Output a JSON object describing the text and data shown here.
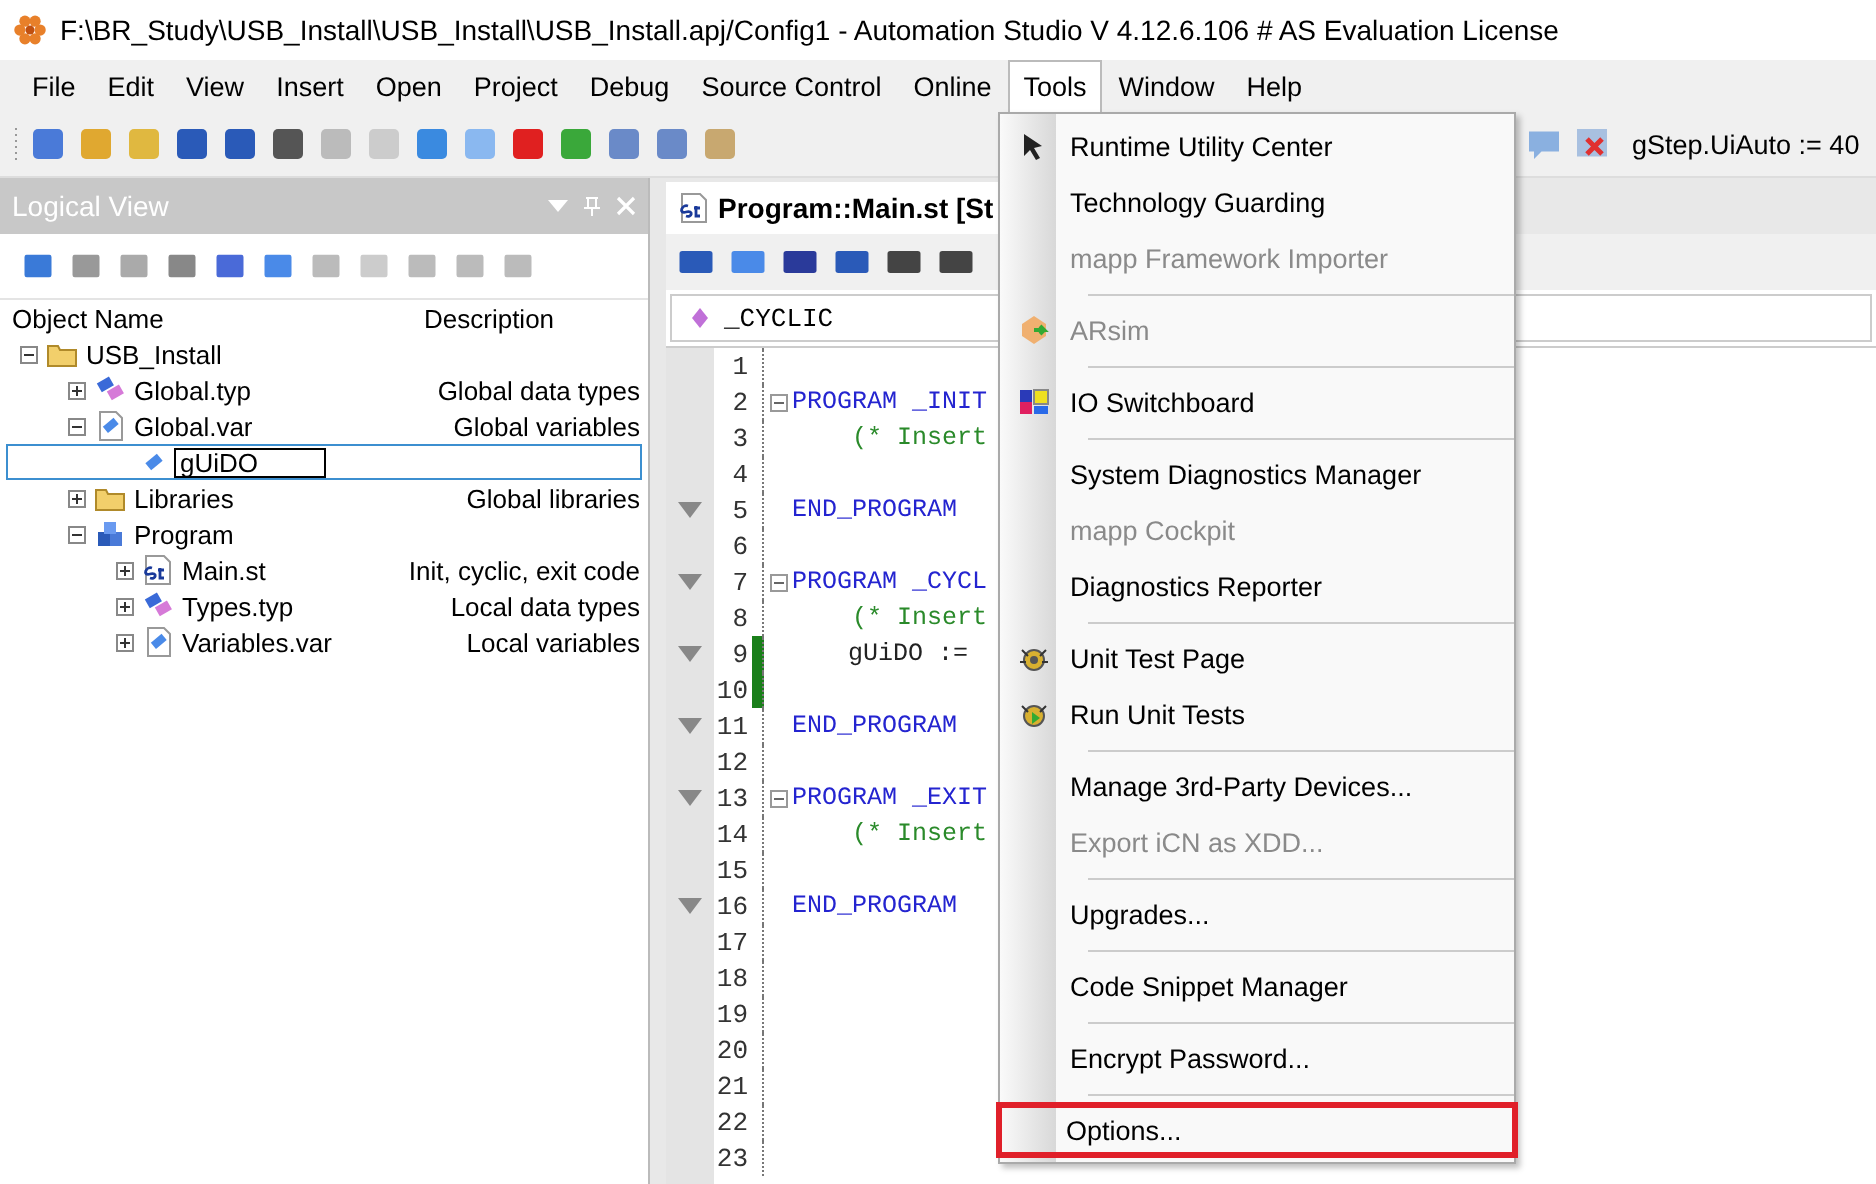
{
  "window": {
    "title": "F:\\BR_Study\\USB_Install\\USB_Install\\USB_Install.apj/Config1 - Automation Studio V 4.12.6.106 # AS Evaluation License"
  },
  "menu_bar": [
    {
      "label": "File",
      "selected": false
    },
    {
      "label": "Edit",
      "selected": false
    },
    {
      "label": "View",
      "selected": false
    },
    {
      "label": "Insert",
      "selected": false
    },
    {
      "label": "Open",
      "selected": false
    },
    {
      "label": "Project",
      "selected": false
    },
    {
      "label": "Debug",
      "selected": false
    },
    {
      "label": "Source Control",
      "selected": false
    },
    {
      "label": "Online",
      "selected": false
    },
    {
      "label": "Tools",
      "selected": true
    },
    {
      "label": "Window",
      "selected": false
    },
    {
      "label": "Help",
      "selected": false
    }
  ],
  "toolbar": {
    "watch_text": "gStep.UiAuto := 40"
  },
  "logical_view": {
    "title": "Logical View",
    "columns": [
      "Object Name",
      "Description"
    ],
    "tree": [
      {
        "name": "USB_Install",
        "kind": "folder",
        "expanded": true,
        "children": [
          {
            "name": "Global.typ",
            "description": "Global data types",
            "kind": "types",
            "expanded": false
          },
          {
            "name": "Global.var",
            "description": "Global variables",
            "kind": "var",
            "expanded": true,
            "children": [
              {
                "name": "gUiDO",
                "kind": "variable",
                "editing": true
              }
            ]
          },
          {
            "name": "Libraries",
            "description": "Global libraries",
            "kind": "folder",
            "expanded": false
          },
          {
            "name": "Program",
            "kind": "program",
            "expanded": true,
            "children": [
              {
                "name": "Main.st",
                "description": "Init, cyclic, exit code",
                "kind": "st",
                "expanded": false
              },
              {
                "name": "Types.typ",
                "description": "Local data types",
                "kind": "types",
                "expanded": false
              },
              {
                "name": "Variables.var",
                "description": "Local variables",
                "kind": "var",
                "expanded": false
              }
            ]
          }
        ]
      }
    ]
  },
  "editor": {
    "tab": "Program::Main.st [St",
    "section": "_CYCLIC",
    "lines": [
      {
        "number": "1"
      },
      {
        "number": "2",
        "text": "PROGRAM _INIT",
        "kind": "keyword",
        "fold": true
      },
      {
        "number": "3",
        "text": "(* Insert",
        "kind": "comment"
      },
      {
        "number": "4"
      },
      {
        "number": "5",
        "text": "END_PROGRAM",
        "kind": "keyword",
        "marker": true
      },
      {
        "number": "6"
      },
      {
        "number": "7",
        "text": "PROGRAM _CYCL",
        "kind": "keyword",
        "fold": true,
        "marker": true
      },
      {
        "number": "8",
        "text": "(* Insert",
        "kind": "comment"
      },
      {
        "number": "9",
        "text": "gUiDO :=",
        "kind": "code",
        "marker": true,
        "changed": true
      },
      {
        "number": "10",
        "changed": true
      },
      {
        "number": "11",
        "text": "END_PROGRAM",
        "kind": "keyword",
        "marker": true
      },
      {
        "number": "12"
      },
      {
        "number": "13",
        "text": "PROGRAM _EXIT",
        "kind": "keyword",
        "fold": true,
        "marker": true
      },
      {
        "number": "14",
        "text": "(* Insert",
        "kind": "comment"
      },
      {
        "number": "15"
      },
      {
        "number": "16",
        "text": "END_PROGRAM",
        "kind": "keyword",
        "marker": true
      },
      {
        "number": "17"
      },
      {
        "number": "18"
      },
      {
        "number": "19"
      },
      {
        "number": "20"
      },
      {
        "number": "21"
      },
      {
        "number": "22"
      },
      {
        "number": "23"
      }
    ]
  },
  "tools_menu": [
    {
      "kind": "item",
      "label": "Runtime Utility Center",
      "disabled": false
    },
    {
      "kind": "item",
      "label": "Technology Guarding",
      "disabled": false
    },
    {
      "kind": "item",
      "label": "mapp Framework Importer",
      "disabled": true
    },
    {
      "kind": "separator"
    },
    {
      "kind": "item",
      "label": "ARsim",
      "disabled": true
    },
    {
      "kind": "separator"
    },
    {
      "kind": "item",
      "label": "IO Switchboard",
      "disabled": false
    },
    {
      "kind": "separator"
    },
    {
      "kind": "item",
      "label": "System Diagnostics Manager",
      "disabled": false
    },
    {
      "kind": "item",
      "label": "mapp Cockpit",
      "disabled": true
    },
    {
      "kind": "item",
      "label": "Diagnostics Reporter",
      "disabled": false
    },
    {
      "kind": "separator"
    },
    {
      "kind": "item",
      "label": "Unit Test Page",
      "disabled": false
    },
    {
      "kind": "item",
      "label": "Run Unit Tests",
      "disabled": false
    },
    {
      "kind": "separator"
    },
    {
      "kind": "item",
      "label": "Manage 3rd-Party Devices...",
      "disabled": false
    },
    {
      "kind": "item",
      "label": "Export iCN as XDD...",
      "disabled": true
    },
    {
      "kind": "separator"
    },
    {
      "kind": "item",
      "label": "Upgrades...",
      "disabled": false
    },
    {
      "kind": "separator"
    },
    {
      "kind": "item",
      "label": "Code Snippet Manager",
      "disabled": false
    },
    {
      "kind": "separator"
    },
    {
      "kind": "item",
      "label": "Encrypt Password...",
      "disabled": false
    },
    {
      "kind": "separator"
    },
    {
      "kind": "item",
      "label": "Options...",
      "disabled": false,
      "highlighted": true
    }
  ]
}
